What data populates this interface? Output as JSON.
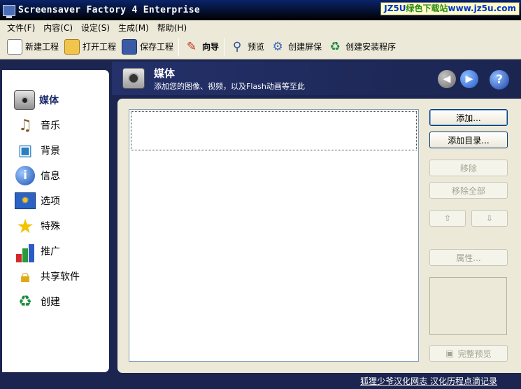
{
  "window": {
    "title": "Screensaver Factory 4 Enterprise",
    "watermark_a": "JZ5U",
    "watermark_b": "绿色下载站",
    "watermark_c": "www.jz5u.com"
  },
  "menu": [
    {
      "label": "文件(F)"
    },
    {
      "label": "内容(C)"
    },
    {
      "label": "设定(S)"
    },
    {
      "label": "生成(M)"
    },
    {
      "label": "帮助(H)"
    }
  ],
  "toolbar": {
    "new_project": "新建工程",
    "open_project": "打开工程",
    "save_project": "保存工程",
    "wizard": "向导",
    "preview": "预览",
    "build_screensaver": "创建屏保",
    "build_installer": "创建安装程序"
  },
  "sidebar": [
    {
      "label": "媒体",
      "icon": "camera-icon"
    },
    {
      "label": "音乐",
      "icon": "music-icon"
    },
    {
      "label": "背景",
      "icon": "background-icon"
    },
    {
      "label": "信息",
      "icon": "info-icon"
    },
    {
      "label": "选项",
      "icon": "options-icon"
    },
    {
      "label": "特殊",
      "icon": "star-icon"
    },
    {
      "label": "推广",
      "icon": "promotion-icon"
    },
    {
      "label": "共享软件",
      "icon": "lock-icon"
    },
    {
      "label": "创建",
      "icon": "build-icon"
    }
  ],
  "header": {
    "title": "媒体",
    "subtitle": "添加您的图像、视频，以及Flash动画等至此"
  },
  "buttons": {
    "add": "添加...",
    "add_folder": "添加目录...",
    "remove": "移除",
    "remove_all": "移除全部",
    "properties": "属性...",
    "full_preview": "完整预览"
  },
  "footer": {
    "link": "狐狸少爷汉化网志 汉化历程点滴记录"
  },
  "colors": {
    "accent": "#1b2550",
    "panel": "#ece9d8",
    "titlebar": "#0a246a"
  }
}
